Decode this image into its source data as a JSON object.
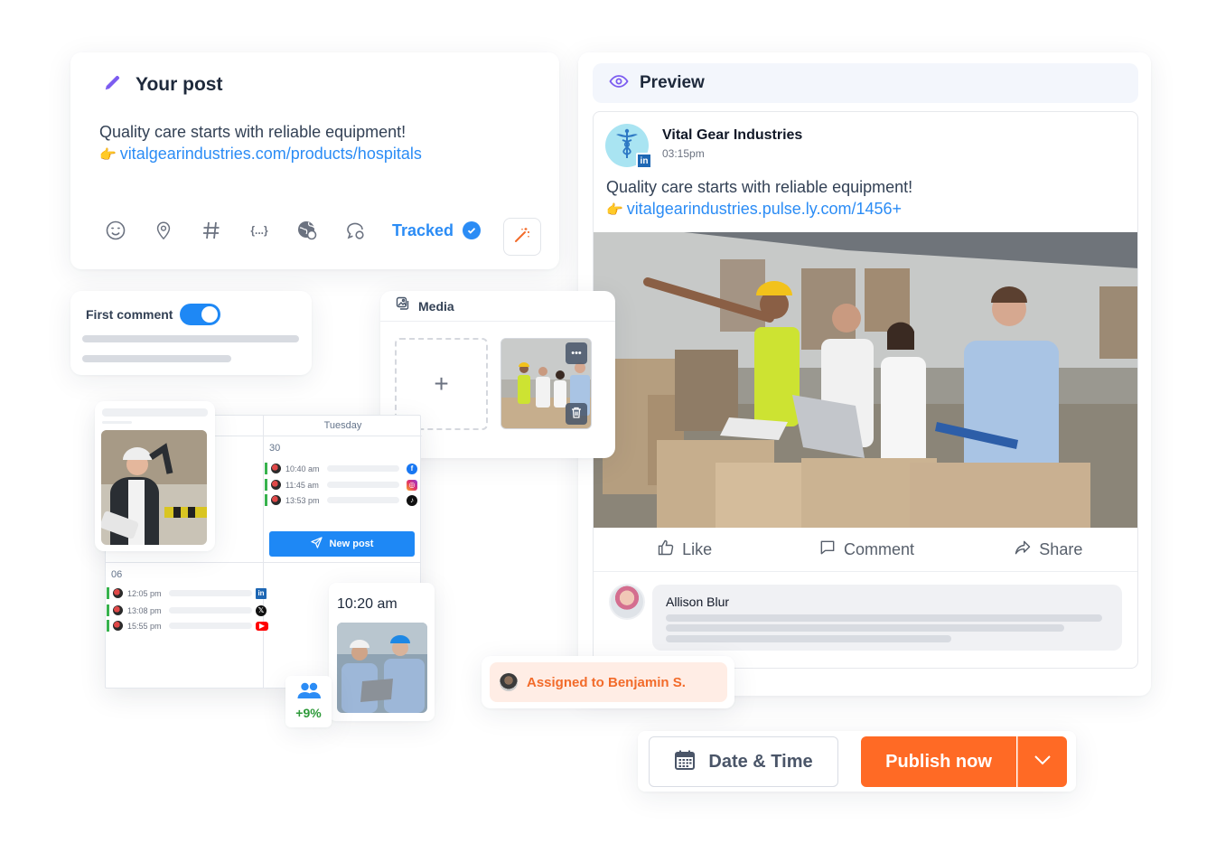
{
  "post_editor": {
    "title": "Your post",
    "text_line": "Quality care starts with reliable equipment!",
    "pointer_emoji": "👉",
    "link": "vitalgearindustries.com/products/hospitals",
    "toolbar": {
      "icons": [
        "emoji-icon",
        "location-pin-icon",
        "hashtag-icon",
        "variables-icon",
        "globe-settings-icon",
        "chat-settings-icon"
      ],
      "variables_glyph": "{...}",
      "hashtag_glyph": "#",
      "tracked_label": "Tracked",
      "tracked": true
    }
  },
  "first_comment": {
    "label": "First comment",
    "enabled": true
  },
  "media": {
    "title": "Media",
    "add_glyph": "+",
    "more_glyph": "•••"
  },
  "calendar": {
    "day_header": "Tuesday",
    "days": [
      {
        "number": "30",
        "events": [
          {
            "time": "10:40 am",
            "network": "facebook"
          },
          {
            "time": "11:45 am",
            "network": "instagram"
          },
          {
            "time": "13:53 pm",
            "network": "tiktok"
          }
        ]
      },
      {
        "number": "06",
        "events": [
          {
            "time": "12:05 pm",
            "network": "linkedin"
          },
          {
            "time": "13:08 pm",
            "network": "x"
          },
          {
            "time": "15:55 pm",
            "network": "youtube"
          }
        ]
      }
    ],
    "new_post_label": "New post"
  },
  "scheduled_card": {
    "time": "10:20 am"
  },
  "growth_card": {
    "value": "+9%"
  },
  "assignment": {
    "label": "Assigned to Benjamin S."
  },
  "preview": {
    "title": "Preview",
    "company_name": "Vital Gear Industries",
    "network_badge": "in",
    "post_time": "03:15pm",
    "text_line": "Quality care starts with reliable equipment!",
    "pointer_emoji": "👉",
    "link": "vitalgearindustries.pulse.ly.com/1456+",
    "actions": {
      "like": "Like",
      "comment": "Comment",
      "share": "Share"
    },
    "comment": {
      "author": "Allison Blur"
    }
  },
  "footer": {
    "date_time_label": "Date & Time",
    "publish_label": "Publish now"
  },
  "colors": {
    "accent_blue": "#2b8cf5",
    "publish_orange": "#ff6a25",
    "assigned_text": "#f26b2a",
    "growth_green": "#2e9a3a",
    "icon_purple": "#7c5cf0"
  }
}
